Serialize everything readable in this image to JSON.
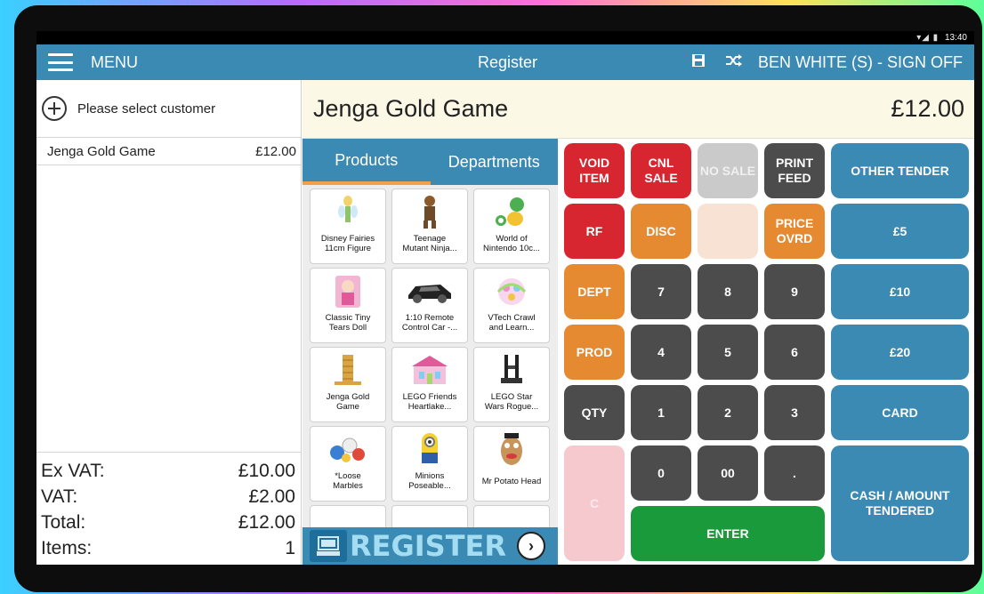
{
  "status_bar": {
    "time": "13:40",
    "signal": "▾◢ ▮"
  },
  "app_bar": {
    "menu_label": "MENU",
    "title": "Register",
    "user_signoff": "BEN WHITE (S) - SIGN OFF"
  },
  "customer": {
    "placeholder": "Please select customer"
  },
  "cart": {
    "items": [
      {
        "name": "Jenga Gold Game",
        "price": "£12.00"
      }
    ]
  },
  "totals": {
    "ex_vat_label": "Ex VAT:",
    "ex_vat": "£10.00",
    "vat_label": "VAT:",
    "vat": "£2.00",
    "total_label": "Total:",
    "total": "£12.00",
    "items_label": "Items:",
    "items": "1"
  },
  "selected_product": {
    "name": "Jenga Gold Game",
    "price": "£12.00"
  },
  "tabs": [
    {
      "label": "Products",
      "active": true
    },
    {
      "label": "Departments",
      "active": false
    }
  ],
  "products": [
    {
      "line1": "Disney Fairies",
      "line2": "11cm Figure",
      "icon": "fairy-figure-icon"
    },
    {
      "line1": "Teenage",
      "line2": "Mutant Ninja...",
      "icon": "ninja-figure-icon"
    },
    {
      "line1": "World of",
      "line2": "Nintendo 10c...",
      "icon": "nintendo-figure-icon"
    },
    {
      "line1": "Classic Tiny",
      "line2": "Tears Doll",
      "icon": "doll-icon"
    },
    {
      "line1": "1:10 Remote",
      "line2": "Control Car -...",
      "icon": "rc-car-icon"
    },
    {
      "line1": "VTech Crawl",
      "line2": "and Learn...",
      "icon": "vtech-toy-icon"
    },
    {
      "line1": "Jenga Gold",
      "line2": "Game",
      "icon": "jenga-icon"
    },
    {
      "line1": "LEGO Friends",
      "line2": "Heartlake...",
      "icon": "lego-friends-icon"
    },
    {
      "line1": "LEGO Star",
      "line2": "Wars Rogue...",
      "icon": "lego-starwars-icon"
    },
    {
      "line1": "*Loose",
      "line2": "Marbles",
      "icon": "marbles-icon"
    },
    {
      "line1": "Minions",
      "line2": "Poseable...",
      "icon": "minion-icon"
    },
    {
      "line1": "Mr Potato Head",
      "line2": "",
      "icon": "potato-head-icon"
    }
  ],
  "register_label": "REGISTER",
  "keypad": {
    "void_item": "VOID ITEM",
    "cnl_sale": "CNL SALE",
    "no_sale": "NO SALE",
    "print_feed": "PRINT FEED",
    "other_tender": "OTHER TENDER",
    "rf": "RF",
    "disc": "DISC",
    "price_ovrd": "PRICE OVRD",
    "five": "£5",
    "dept": "DEPT",
    "ten": "£10",
    "prod": "PROD",
    "twenty": "£20",
    "qty": "QTY",
    "card": "CARD",
    "c": "C",
    "zero": "0",
    "double_zero": "00",
    "dot": ".",
    "enter": "ENTER",
    "cash": "CASH / AMOUNT TENDERED",
    "digits": [
      "7",
      "8",
      "9",
      "4",
      "5",
      "6",
      "1",
      "2",
      "3"
    ]
  },
  "colors": {
    "appbar": "#3a8ab3",
    "red": "#d72630",
    "orange": "#e68a32",
    "grey": "#4c4c4c",
    "green": "#1a9a3b",
    "blue": "#3a8ab3"
  }
}
